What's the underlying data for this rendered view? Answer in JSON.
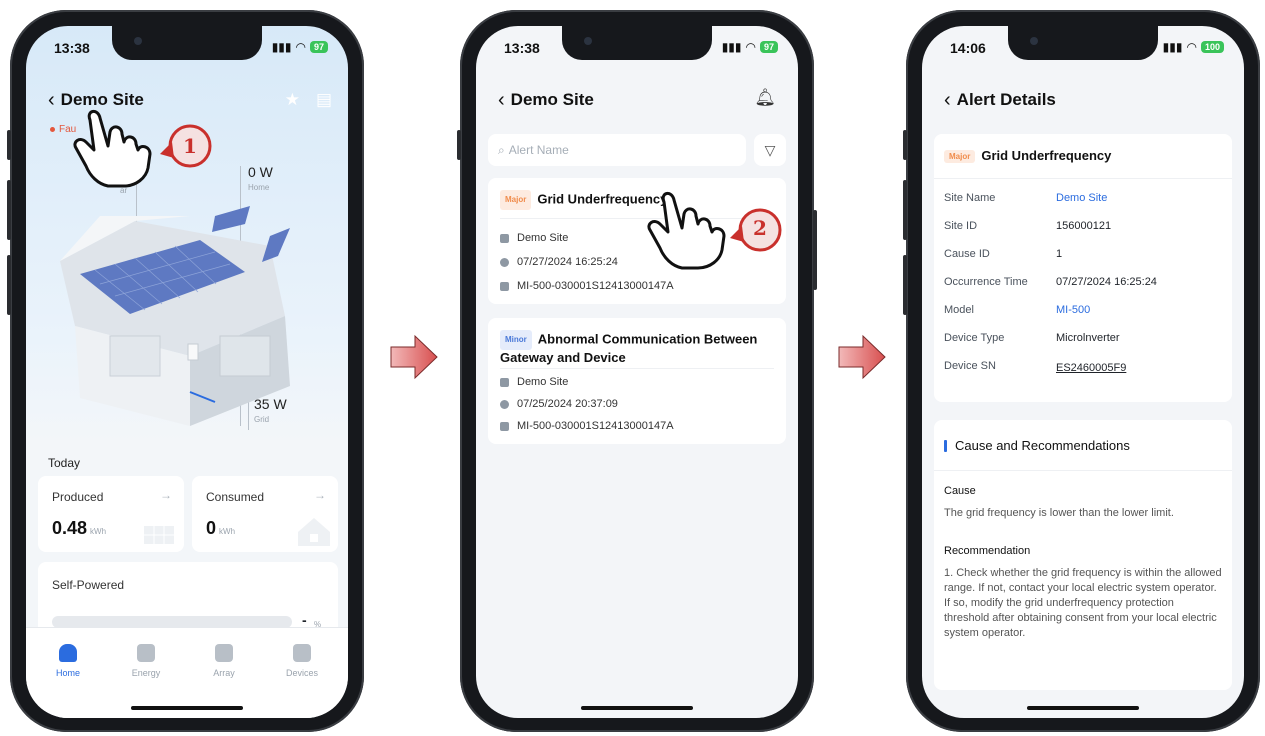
{
  "colors": {
    "accent": "#2b6cdf",
    "fault": "#e4573d",
    "arrow": "#e07272"
  },
  "phone1": {
    "time": "13:38",
    "battery": "97",
    "title": "Demo Site",
    "fault_label": "Fau",
    "home_value": "0 W",
    "home_label": "Home",
    "solar_label": "ar",
    "grid_value": "35 W",
    "grid_label": "Grid",
    "today_label": "Today",
    "produced": {
      "label": "Produced",
      "value": "0.48",
      "unit": "kWh"
    },
    "consumed": {
      "label": "Consumed",
      "value": "0",
      "unit": "kWh"
    },
    "self_powered": {
      "label": "Self-Powered",
      "value": "-",
      "unit": "%"
    },
    "tabs": [
      {
        "label": "Home",
        "active": true
      },
      {
        "label": "Energy",
        "active": false
      },
      {
        "label": "Array",
        "active": false
      },
      {
        "label": "Devices",
        "active": false
      }
    ],
    "step_badge": "1"
  },
  "phone2": {
    "time": "13:38",
    "battery": "97",
    "title": "Demo Site",
    "search_placeholder": "Alert Name",
    "alerts": [
      {
        "level": "Major",
        "title": "Grid Underfrequency",
        "site": "Demo Site",
        "time": "07/27/2024 16:25:24",
        "device": "MI-500-030001S12413000147A"
      },
      {
        "level": "Minor",
        "title": "Abnormal Communication Between Gateway and Device",
        "site": "Demo Site",
        "time": "07/25/2024 20:37:09",
        "device": "MI-500-030001S12413000147A"
      }
    ],
    "step_badge": "2"
  },
  "phone3": {
    "time": "14:06",
    "battery": "100",
    "title": "Alert Details",
    "level": "Major",
    "alert_title": "Grid Underfrequency",
    "fields": [
      {
        "label": "Site Name",
        "value": "Demo Site"
      },
      {
        "label": "Site ID",
        "value": "156000121"
      },
      {
        "label": "Cause ID",
        "value": "1"
      },
      {
        "label": "Occurrence Time",
        "value": "07/27/2024 16:25:24"
      },
      {
        "label": "Model",
        "value": "MI-500"
      },
      {
        "label": "Device Type",
        "value": "Microlnverter"
      },
      {
        "label": "Device SN",
        "value": "ES2460005F9"
      }
    ],
    "section_title": "Cause and Recommendations",
    "cause_heading": "Cause",
    "cause_text": "The grid frequency is lower than the lower limit.",
    "rec_heading": "Recommendation",
    "rec_text": "1. Check whether the grid frequency is within the allowed range. If not, contact your local electric system operator. If so, modify the grid underfrequency protection threshold after obtaining consent from your local electric system operator."
  }
}
